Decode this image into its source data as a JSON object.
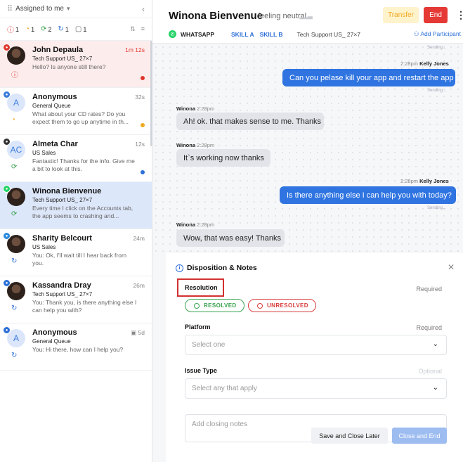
{
  "sidebar": {
    "title": "Assigned to me",
    "filters": [
      {
        "icon": "ⓘ",
        "count": "1",
        "color": "#e0352b"
      },
      {
        "icon": "◔",
        "count": "1",
        "color": "#f0a820"
      },
      {
        "icon": "⟳",
        "count": "2",
        "color": "#37a24d"
      },
      {
        "icon": "↻",
        "count": "1",
        "color": "#2b6fd6"
      },
      {
        "icon": "▢",
        "count": "1",
        "color": "#666"
      }
    ],
    "conversations": [
      {
        "name": "John Depaula",
        "queue": "Tech Support US_ 27×7",
        "message": "Hello? Is anyone still there?",
        "time": "1m 12s",
        "initials": "",
        "dot": "#e0352b"
      },
      {
        "name": "Anonymous",
        "queue": "General Queue",
        "message": "What about your CD rates? Do you expect them to go up anytime in th...",
        "time": "32s",
        "initials": "A",
        "dot": "#f0a820"
      },
      {
        "name": "Almeta Char",
        "queue": "US Sales",
        "message": "Fantastic! Thanks for the info. Give me a bit to look at this.",
        "time": "12s",
        "initials": "AC",
        "dot": "#2b6fd6"
      },
      {
        "name": "Winona Bienvenue",
        "queue": "Tech Support US_ 27×7",
        "message": "Every time I click on the Accounts tab, the app seems to crashing and...",
        "time": "",
        "initials": "",
        "dot": ""
      },
      {
        "name": "Sharity Belcourt",
        "queue": "US Sales",
        "message": "You: Ok, I'll wait till I hear back from you.",
        "time": "24m",
        "initials": "",
        "dot": ""
      },
      {
        "name": "Kassandra Dray",
        "queue": "Tech Support US_ 27×7",
        "message": "You: Thank you, is there anything else I can help you with?",
        "time": "26m",
        "initials": "",
        "dot": ""
      },
      {
        "name": "Anonymous",
        "queue": "General Queue",
        "message": "You: Hi there, how can I help you?",
        "time": "5d",
        "initials": "A",
        "dot": ""
      }
    ]
  },
  "header": {
    "contact_name": "Winona Bienvenue",
    "mood": "feeling neutral",
    "transfer_label": "Transfer",
    "end_label": "End",
    "channel": "WHATSAPP",
    "skills": [
      "SKILL A",
      "SKILL B"
    ],
    "team": "Tech Support US_ 27×7",
    "add_participant": "Add Participant"
  },
  "chat": {
    "messages": [
      {
        "dir": "out",
        "status": "Sending...",
        "time": "",
        "sender": "",
        "text": ""
      },
      {
        "dir": "out",
        "time": "2:28pm",
        "sender": "Kelly Jones",
        "text": "Can you pelase kill your app and restart the app",
        "status": "Sending..."
      },
      {
        "dir": "in",
        "time": "2:28pm",
        "sender": "Winona",
        "text": "Ah! ok. that makes sense to me. Thanks",
        "status": ""
      },
      {
        "dir": "in",
        "time": "2:28pm",
        "sender": "Winona",
        "text": "It`s working now thanks",
        "status": ""
      },
      {
        "dir": "out",
        "time": "2:28pm",
        "sender": "Kelly Jones",
        "text": "Is there anything else I can help you with today?",
        "status": "Sending..."
      },
      {
        "dir": "in",
        "time": "2:28pm",
        "sender": "Winona",
        "text": "Wow, that was easy! Thanks",
        "status": ""
      }
    ]
  },
  "disposition": {
    "title": "Disposition & Notes",
    "resolution_label": "Resolution",
    "resolution_required": "Required",
    "resolved_label": "RESOLVED",
    "unresolved_label": "UNRESOLVED",
    "platform_label": "Platform",
    "platform_required": "Required",
    "platform_placeholder": "Select one",
    "issue_label": "Issue Type",
    "issue_optional": "Optional",
    "issue_placeholder": "Select any that apply",
    "notes_placeholder": "Add closing notes",
    "save_label": "Save and Close Later",
    "close_end_label": "Close and End"
  }
}
